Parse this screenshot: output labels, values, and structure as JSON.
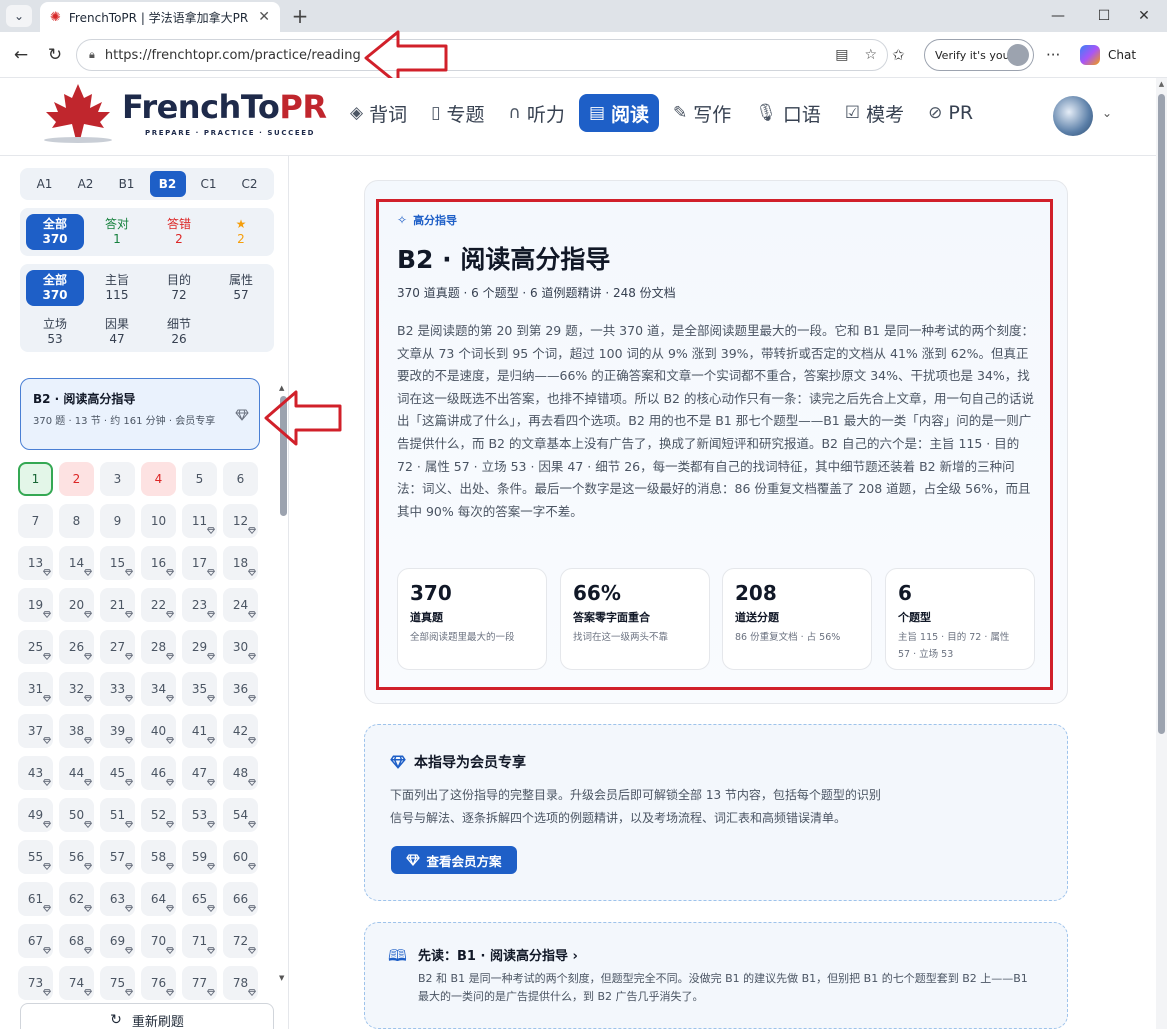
{
  "browser": {
    "tab_title": "FrenchToPR | 学法语拿加拿大PR | 顶",
    "url": "https://frenchtopr.com/practice/reading",
    "verify_label": "Verify it's you",
    "chat_label": "Chat"
  },
  "site": {
    "logo_main": "FrenchTo",
    "logo_pr": "PR",
    "logo_tagline": "PREPARE · PRACTICE · SUCCEED",
    "nav": [
      {
        "label": "背词",
        "icon": "layers-icon"
      },
      {
        "label": "专题",
        "icon": "book-icon"
      },
      {
        "label": "听力",
        "icon": "headphones-icon"
      },
      {
        "label": "阅读",
        "icon": "document-icon",
        "active": true
      },
      {
        "label": "写作",
        "icon": "pen-icon"
      },
      {
        "label": "口语",
        "icon": "mic-icon"
      },
      {
        "label": "模考",
        "icon": "clipboard-icon"
      },
      {
        "label": "PR",
        "icon": "compass-icon"
      }
    ]
  },
  "sidebar": {
    "levels": [
      "A1",
      "A2",
      "B1",
      "B2",
      "C1",
      "C2"
    ],
    "active_level": "B2",
    "status_filters": [
      {
        "label": "全部",
        "count": "370",
        "active": true
      },
      {
        "label": "答对",
        "count": "1",
        "color": "green"
      },
      {
        "label": "答错",
        "count": "2",
        "color": "red"
      },
      {
        "label": "★",
        "count": "2",
        "color": "orange"
      }
    ],
    "type_filters": [
      {
        "label": "全部",
        "count": "370",
        "active": true
      },
      {
        "label": "主旨",
        "count": "115"
      },
      {
        "label": "目的",
        "count": "72"
      },
      {
        "label": "属性",
        "count": "57"
      },
      {
        "label": "立场",
        "count": "53"
      },
      {
        "label": "因果",
        "count": "47"
      },
      {
        "label": "细节",
        "count": "26"
      }
    ],
    "guide_card": {
      "title": "B2 · 阅读高分指导",
      "meta": "370 题 · 13 节 · 约 161 分钟 · 会员专享"
    },
    "questions_visible": 78,
    "done_questions": [
      1
    ],
    "wrong_questions": [
      2,
      4
    ],
    "refresh_label": "重新刷题"
  },
  "guide": {
    "tag": "高分指导",
    "title": "B2 · 阅读高分指导",
    "subtitle": "370 道真题 · 6 个题型 · 6 道例题精讲 · 248 份文档",
    "paragraph": "B2 是阅读题的第 20 到第 29 题，一共 370 道，是全部阅读题里最大的一段。它和 B1 是同一种考试的两个刻度：文章从 73 个词长到 95 个词，超过 100 词的从 9% 涨到 39%，带转折或否定的文档从 41% 涨到 62%。但真正要改的不是速度，是归纳——66% 的正确答案和文章一个实词都不重合，答案抄原文 34%、干扰项也是 34%，找词在这一级既选不出答案，也排不掉错项。所以 B2 的核心动作只有一条：读完之后先合上文章，用一句自己的话说出「这篇讲成了什么」，再去看四个选项。B2 用的也不是 B1 那七个题型——B1 最大的一类「内容」问的是一则广告提供什么，而 B2 的文章基本上没有广告了，换成了新闻短评和研究报道。B2 自己的六个是：主旨 115 · 目的 72 · 属性 57 · 立场 53 · 因果 47 · 细节 26，每一类都有自己的找词特征，其中细节题还装着 B2 新增的三种问法：词义、出处、条件。最后一个数字是这一级最好的消息：86 份重复文档覆盖了 208 道题，占全级 56%，而且其中 90% 每次的答案一字不差。",
    "stats": [
      {
        "value": "370",
        "label": "道真题",
        "desc": "全部阅读题里最大的一段"
      },
      {
        "value": "66%",
        "label": "答案零字面重合",
        "desc": "找词在这一级两头不靠"
      },
      {
        "value": "208",
        "label": "道送分题",
        "desc": "86 份重复文档 · 占 56%"
      },
      {
        "value": "6",
        "label": "个题型",
        "desc": "主旨 115 · 目的 72 · 属性 57 · 立场 53"
      }
    ]
  },
  "member": {
    "title": "本指导为会员专享",
    "desc_line1": "下面列出了这份指导的完整目录。升级会员后即可解锁全部 13 节内容，包括每个题型的识别",
    "desc_line2": "信号与解法、逐条拆解四个选项的例题精讲，以及考场流程、词汇表和高频错误清单。",
    "button": "查看会员方案"
  },
  "prev": {
    "title": "先读：B1 · 阅读高分指导 ›",
    "desc": "B2 和 B1 是同一种考试的两个刻度，但题型完全不同。没做完 B1 的建议先做 B1，但别把 B1 的七个题型套到 B2 上——B1 最大的一类问的是广告提供什么，到 B2 广告几乎消失了。"
  },
  "colors": {
    "primary": "#1e5fc7",
    "highlight": "#d1202a",
    "correct": "#15803d",
    "wrong": "#dc2626"
  }
}
